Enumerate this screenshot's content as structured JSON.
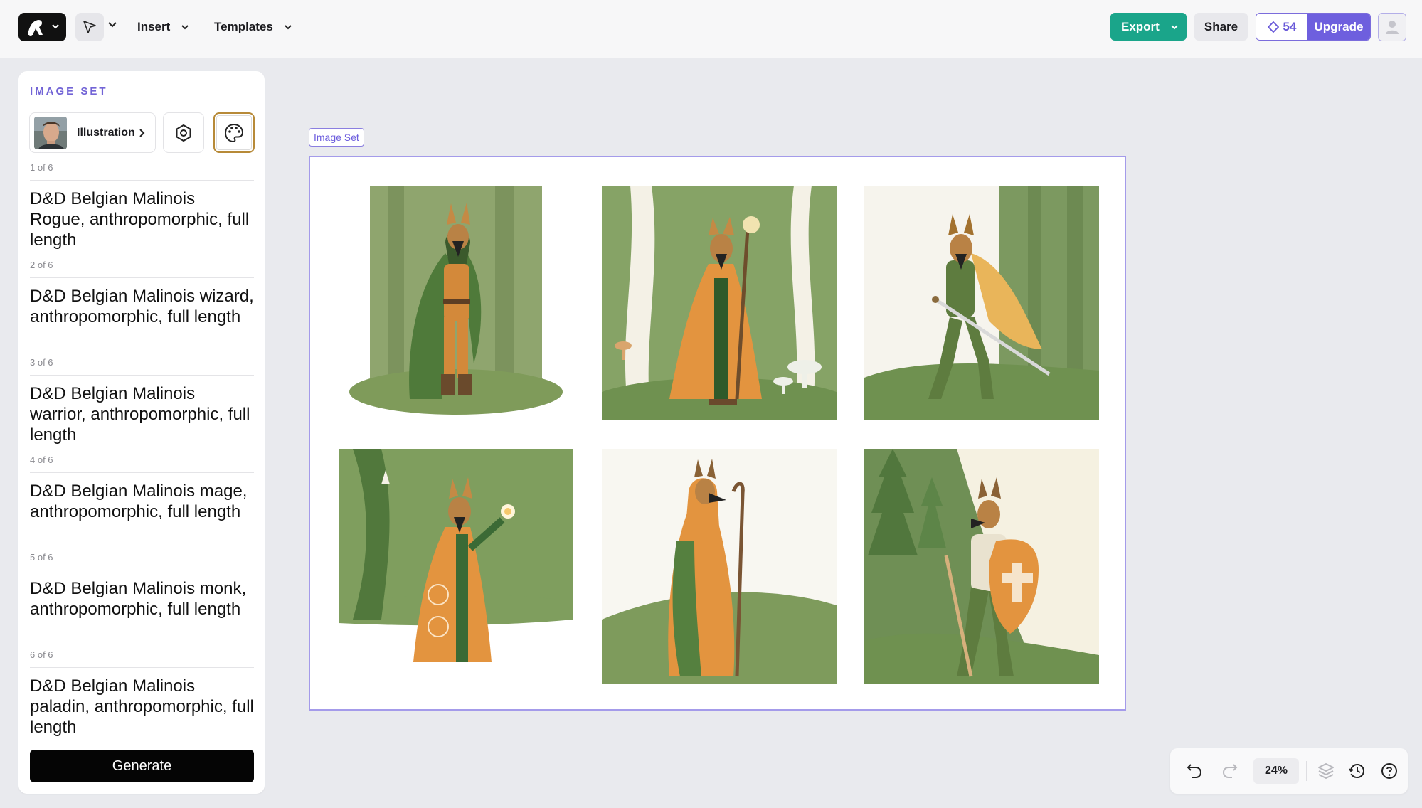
{
  "toolbar": {
    "insert_label": "Insert",
    "templates_label": "Templates",
    "export_label": "Export",
    "share_label": "Share",
    "credits": "54",
    "upgrade_label": "Upgrade",
    "icons": [
      "logo-icon",
      "cursor-icon",
      "chevron-down-icon",
      "gem-icon",
      "user-icon"
    ]
  },
  "panel": {
    "title": "IMAGE SET",
    "style_label": "Illustration",
    "prompts": [
      {
        "count": "1 of 6",
        "text": "D&D Belgian Malinois Rogue, anthropomorphic, full length"
      },
      {
        "count": "2 of 6",
        "text": "D&D Belgian Malinois wizard, anthropomorphic, full length"
      },
      {
        "count": "3 of 6",
        "text": "D&D Belgian Malinois warrior, anthropomorphic, full length"
      },
      {
        "count": "4 of 6",
        "text": "D&D Belgian Malinois mage, anthropomorphic, full length"
      },
      {
        "count": "5 of 6",
        "text": "D&D Belgian Malinois monk, anthropomorphic, full length"
      },
      {
        "count": "6 of 6",
        "text": "D&D Belgian Malinois paladin, anthropomorphic, full length"
      }
    ],
    "generate_label": "Generate"
  },
  "canvas": {
    "frame_label": "Image Set",
    "images": [
      "rogue",
      "wizard",
      "warrior",
      "mage",
      "monk",
      "paladin"
    ]
  },
  "bottom_bar": {
    "zoom": "24%",
    "icons": [
      "undo-icon",
      "redo-icon",
      "layers-icon",
      "history-icon",
      "help-icon"
    ]
  },
  "colors": {
    "accent": "#6e5fde",
    "export": "#1aa58a",
    "forest_green": "#6f8f55",
    "robe_orange": "#e39a45"
  }
}
